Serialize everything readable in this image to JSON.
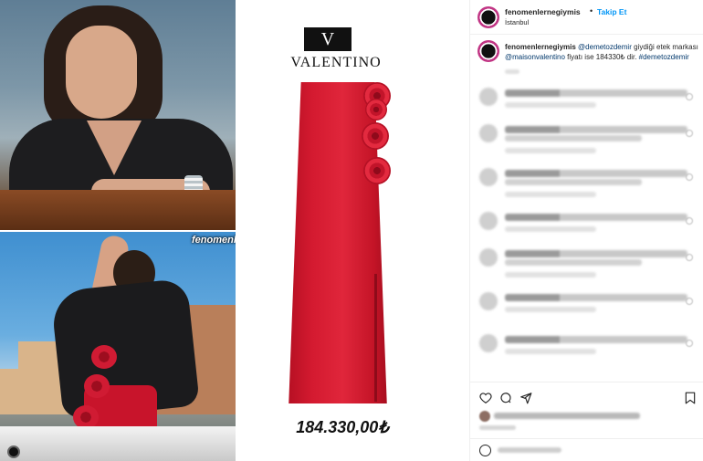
{
  "collage": {
    "watermark": "fenomenlernegiymis"
  },
  "product": {
    "brand_monogram": "V",
    "brand_name": "VALENTINO",
    "price": "184.330,00₺"
  },
  "instagram": {
    "username": "fenomenlernegiymis",
    "separator": "•",
    "follow_label": "Takip Et",
    "location": "İstanbul",
    "caption_user": "fenomenlernegiymis",
    "caption_mention": "@demetozdemir",
    "caption_text_1": "giydiği etek markası",
    "caption_mention_2": "@maisonvalentino",
    "caption_text_2": "fiyatı ise 184330₺ dir.",
    "caption_tag": "#demetozdemir",
    "colors": {
      "follow": "#0095f6",
      "link": "#00376b",
      "text": "#262626",
      "brand_red": "#d41a30"
    },
    "icons": [
      "heart-icon",
      "comment-icon",
      "share-icon",
      "bookmark-icon",
      "emoji-icon"
    ]
  }
}
